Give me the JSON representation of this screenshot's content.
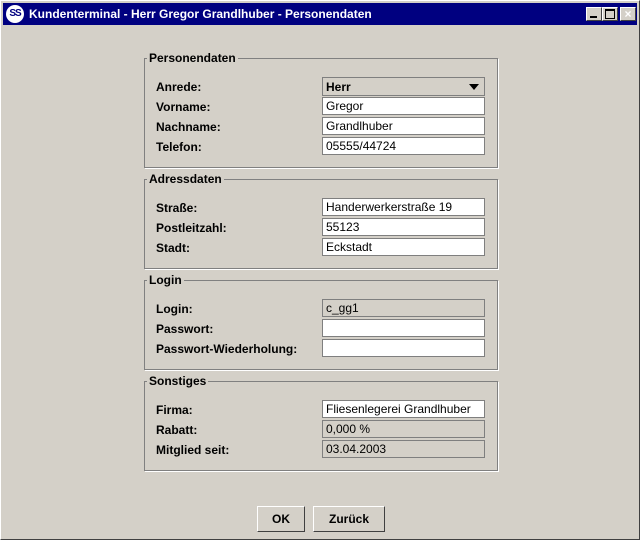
{
  "window": {
    "icon_text": "SS",
    "title": "Kundenterminal - Herr Gregor Grandlhuber - Personendaten",
    "controls": {
      "minimize": "minimize-icon",
      "maximize": "maximize-icon",
      "close": "close-icon"
    }
  },
  "personendaten": {
    "legend": "Personendaten",
    "anrede_label": "Anrede:",
    "anrede_value": "Herr",
    "vorname_label": "Vorname:",
    "vorname_value": "Gregor",
    "nachname_label": "Nachname:",
    "nachname_value": "Grandlhuber",
    "telefon_label": "Telefon:",
    "telefon_value": "05555/44724"
  },
  "adressdaten": {
    "legend": "Adressdaten",
    "strasse_label": "Straße:",
    "strasse_value": "Handerwerkerstraße 19",
    "plz_label": "Postleitzahl:",
    "plz_value": "55123",
    "stadt_label": "Stadt:",
    "stadt_value": "Eckstadt"
  },
  "login": {
    "legend": "Login",
    "login_label": "Login:",
    "login_value": "c_gg1",
    "passwort_label": "Passwort:",
    "passwort_value": "",
    "wiederholung_label": "Passwort-Wiederholung:",
    "wiederholung_value": ""
  },
  "sonstiges": {
    "legend": "Sonstiges",
    "firma_label": "Firma:",
    "firma_value": "Fliesenlegerei Grandlhuber",
    "rabatt_label": "Rabatt:",
    "rabatt_value": "0,000 %",
    "mitglied_label": "Mitglied seit:",
    "mitglied_value": "03.04.2003"
  },
  "buttons": {
    "ok": "OK",
    "zurueck": "Zurück"
  },
  "colors": {
    "titlebar": "#000080",
    "face": "#d4d0c8",
    "field": "#ffffff"
  }
}
